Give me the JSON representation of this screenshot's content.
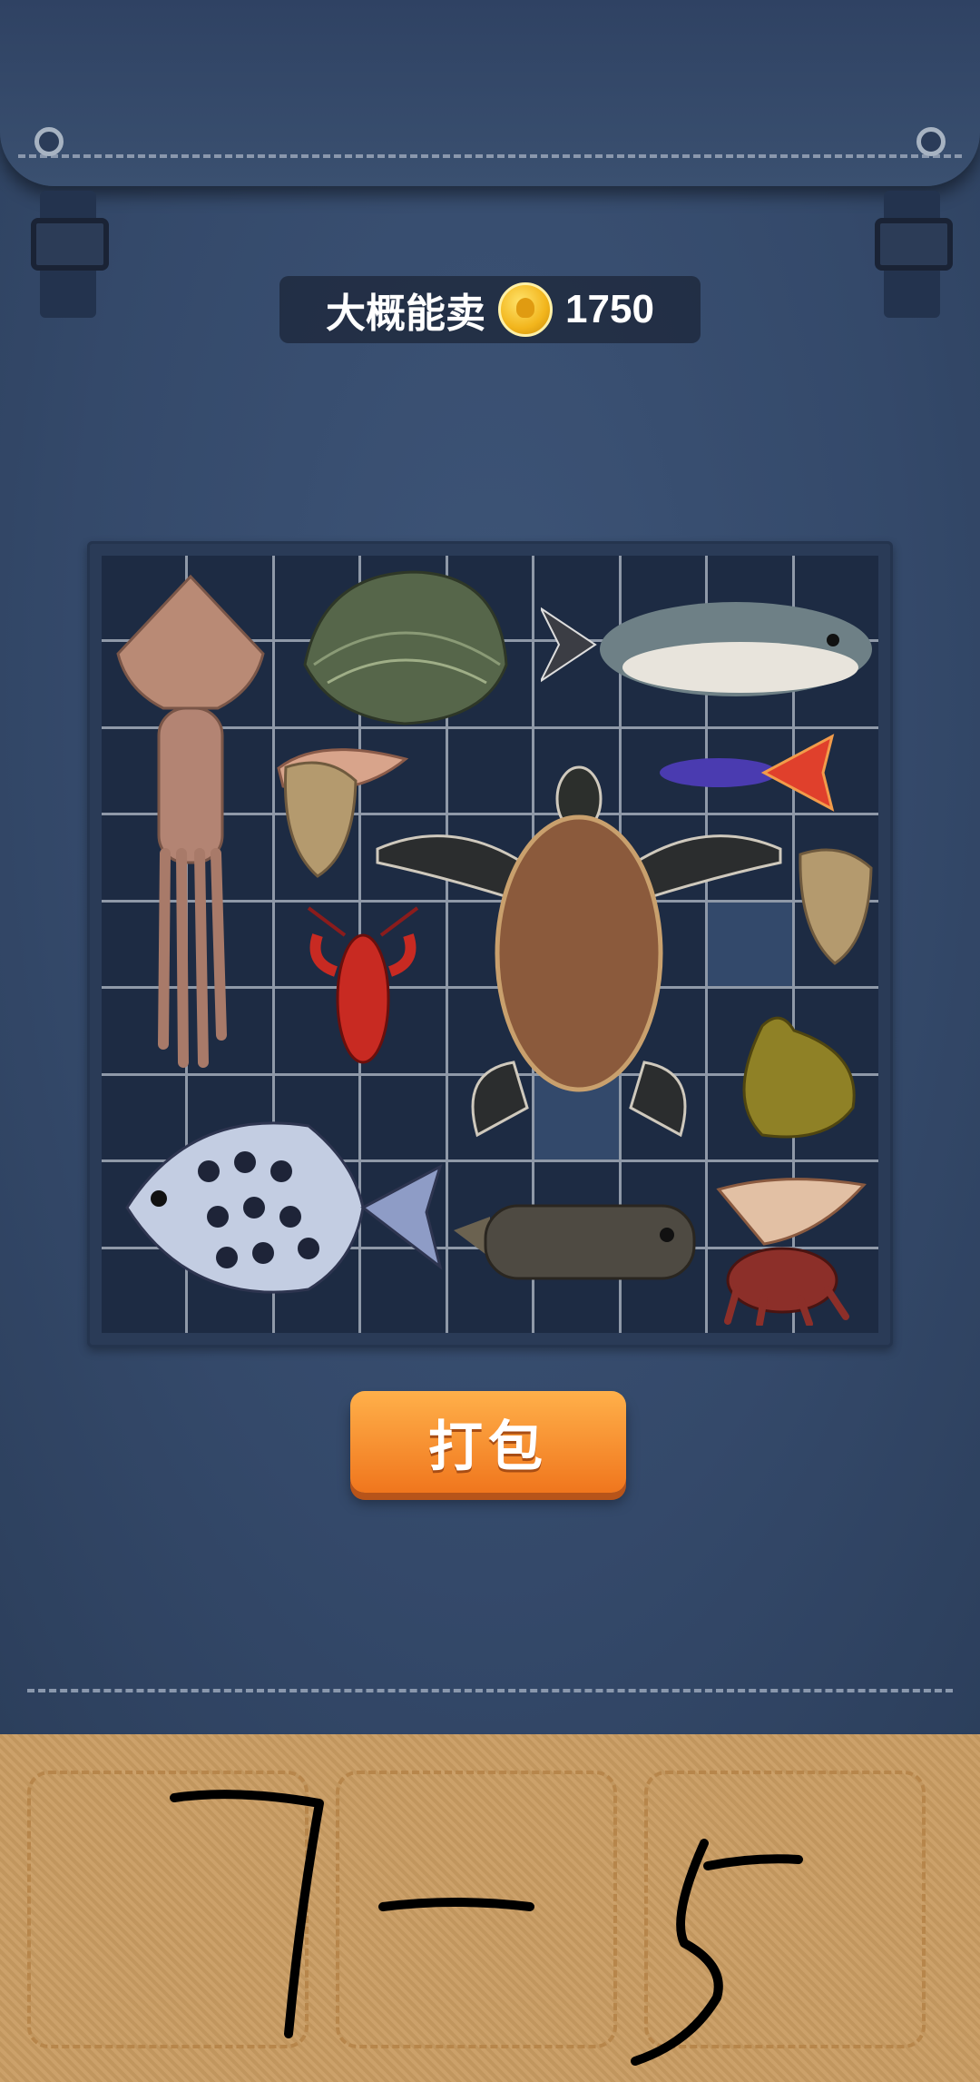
{
  "header": {
    "price_label": "大概能卖",
    "price_value": "1750",
    "coin_icon": "gold-coin-icon"
  },
  "grid": {
    "columns": 9,
    "rows": 9,
    "empty_highlight_cells": [
      [
        7,
        4
      ],
      [
        5,
        6
      ]
    ]
  },
  "items": [
    {
      "name": "squid"
    },
    {
      "name": "clam"
    },
    {
      "name": "pufferfish"
    },
    {
      "name": "oyster"
    },
    {
      "name": "conch-shell"
    },
    {
      "name": "guppy-fish"
    },
    {
      "name": "sea-turtle"
    },
    {
      "name": "oyster"
    },
    {
      "name": "crayfish"
    },
    {
      "name": "apple-snail"
    },
    {
      "name": "scat-fish"
    },
    {
      "name": "boxfish"
    },
    {
      "name": "hermit-crab"
    }
  ],
  "action": {
    "pack_label": "打包"
  },
  "handwriting": {
    "text": "7-5"
  }
}
